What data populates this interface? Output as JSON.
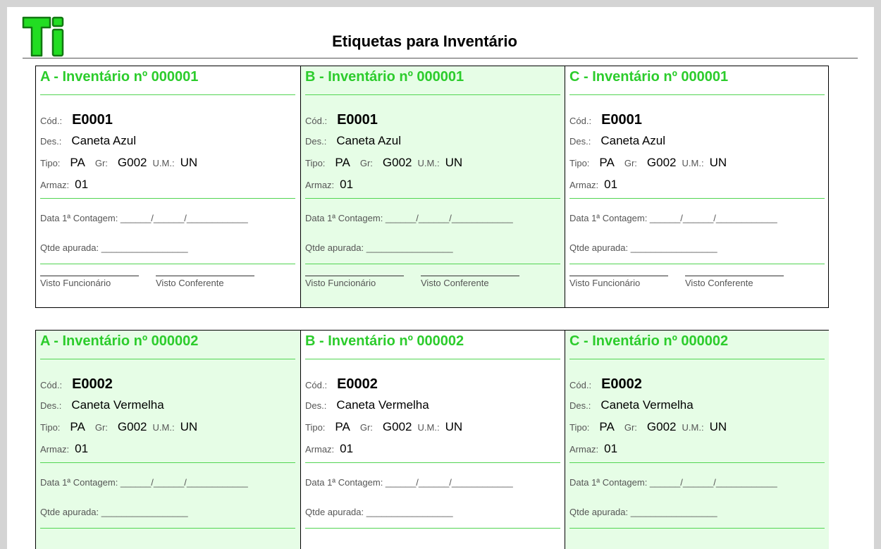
{
  "document": {
    "title": "Etiquetas para Inventário",
    "logo_text": "Ti",
    "colors": {
      "accent": "#2ccc2c",
      "tint": "#e6fde6",
      "rule": "#52d552"
    }
  },
  "field_labels": {
    "cod": "Cód.:",
    "des": "Des.:",
    "tipo": "Tipo:",
    "grupo": "Gr:",
    "um": "U.M.:",
    "armaz": "Armaz:",
    "data_contagem": "Data 1ª Contagem: ______/______/____________",
    "qtde_apurada": "Qtde apurada: _________________",
    "visto_funcionario": "Visto Funcionário",
    "visto_conferente": "Visto Conferente"
  },
  "rows": [
    {
      "cards": [
        {
          "title": "A - Inventário nº 000001",
          "cod": "E0001",
          "des": "Caneta Azul",
          "tipo": "PA",
          "grupo": "G002",
          "um": "UN",
          "armaz": "01"
        },
        {
          "title": "B - Inventário nº 000001",
          "cod": "E0001",
          "des": "Caneta Azul",
          "tipo": "PA",
          "grupo": "G002",
          "um": "UN",
          "armaz": "01"
        },
        {
          "title": "C - Inventário nº 000001",
          "cod": "E0001",
          "des": "Caneta Azul",
          "tipo": "PA",
          "grupo": "G002",
          "um": "UN",
          "armaz": "01"
        }
      ]
    },
    {
      "cards": [
        {
          "title": "A - Inventário nº 000002",
          "cod": "E0002",
          "des": "Caneta Vermelha",
          "tipo": "PA",
          "grupo": "G002",
          "um": "UN",
          "armaz": "01"
        },
        {
          "title": "B - Inventário nº 000002",
          "cod": "E0002",
          "des": "Caneta Vermelha",
          "tipo": "PA",
          "grupo": "G002",
          "um": "UN",
          "armaz": "01"
        },
        {
          "title": "C - Inventário nº 000002",
          "cod": "E0002",
          "des": "Caneta Vermelha",
          "tipo": "PA",
          "grupo": "G002",
          "um": "UN",
          "armaz": "01"
        }
      ]
    }
  ]
}
